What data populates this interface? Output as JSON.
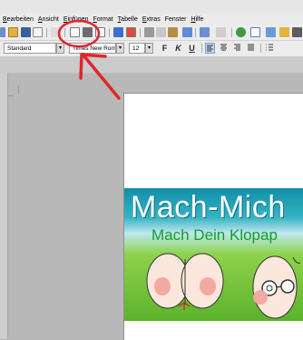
{
  "menu": {
    "items": [
      {
        "underline": "B",
        "rest": "earbeiten"
      },
      {
        "underline": "A",
        "rest": "nsicht"
      },
      {
        "underline": "E",
        "rest": "infügen"
      },
      {
        "underline": "F",
        "rest": "ormat"
      },
      {
        "underline": "T",
        "rest": "abelle"
      },
      {
        "underline": "E",
        "rest": "xtras"
      },
      {
        "underline": "",
        "rest": "Fenster"
      },
      {
        "underline": "H",
        "rest": "ilfe"
      }
    ]
  },
  "toolbar": {
    "paragraph_style": "Standard",
    "font_name": "Times New Roman",
    "font_size": "12",
    "bold_label": "F",
    "italic_label": "K",
    "underline_label": "U"
  },
  "document": {
    "banner_title": "Mach-Mich",
    "banner_subtitle": "Mach Dein Klopap"
  },
  "colors": {
    "annotation": "#e0262b",
    "banner_title": "#ffffff",
    "banner_subtitle": "#149e2a"
  }
}
